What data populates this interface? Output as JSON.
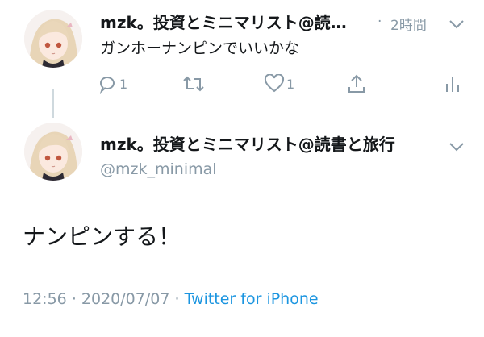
{
  "tweet1": {
    "display_name": "mzk。投資とミニマリスト@読…",
    "separator": "·",
    "time": "2時間",
    "text": "ガンホーナンピンでいいかな",
    "reply_count": "1",
    "like_count": "1",
    "icons": [
      "reply-icon",
      "retweet-icon",
      "like-icon",
      "share-icon",
      "analytics-icon",
      "chevron-down-icon"
    ]
  },
  "tweet2": {
    "display_name": "mzk。投資とミニマリスト@読書と旅行",
    "handle": "@mzk_minimal",
    "text": "ナンピンする！",
    "time": "12:56",
    "sep1": "·",
    "date": "2020/07/07",
    "sep2": "·",
    "source": "Twitter for iPhone"
  },
  "colors": {
    "text": "#14171a",
    "muted": "#8899a6",
    "link": "#1b95e0",
    "line": "#cfd9de"
  }
}
